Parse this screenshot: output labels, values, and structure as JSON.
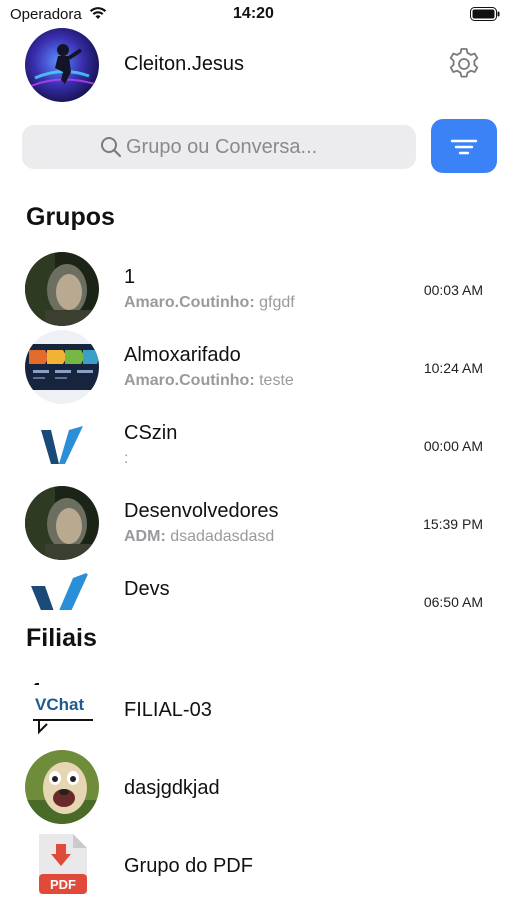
{
  "status_bar": {
    "carrier": "Operadora",
    "time": "14:20"
  },
  "header": {
    "user_name": "Cleiton.Jesus"
  },
  "search": {
    "placeholder": "Grupo ou Conversa..."
  },
  "sections": {
    "groups_title": "Grupos",
    "branches_title": "Filiais"
  },
  "groups": [
    {
      "name": "1",
      "sender": "Amaro.Coutinho:",
      "message": "gfgdf",
      "time": "00:03 AM"
    },
    {
      "name": "Almoxarifado",
      "sender": "Amaro.Coutinho:",
      "message": "teste",
      "time": "10:24 AM"
    },
    {
      "name": "CSzin",
      "sender": "",
      "message": ":",
      "time": "00:00 AM"
    },
    {
      "name": "Desenvolvedores",
      "sender": "ADM:",
      "message": "dsadadasdasd",
      "time": "15:39 PM"
    },
    {
      "name": "Devs",
      "sender": "",
      "message": "",
      "time": "06:50 AM"
    }
  ],
  "branches": [
    {
      "name": "FILIAL-03",
      "logo_text": "VChat"
    },
    {
      "name": "dasjgdkjad"
    },
    {
      "name": "Grupo do PDF",
      "icon_text": "PDF"
    }
  ],
  "colors": {
    "accent": "#3b82f6",
    "search_bg": "#ececee",
    "secondary_text": "#9a9a9e"
  }
}
